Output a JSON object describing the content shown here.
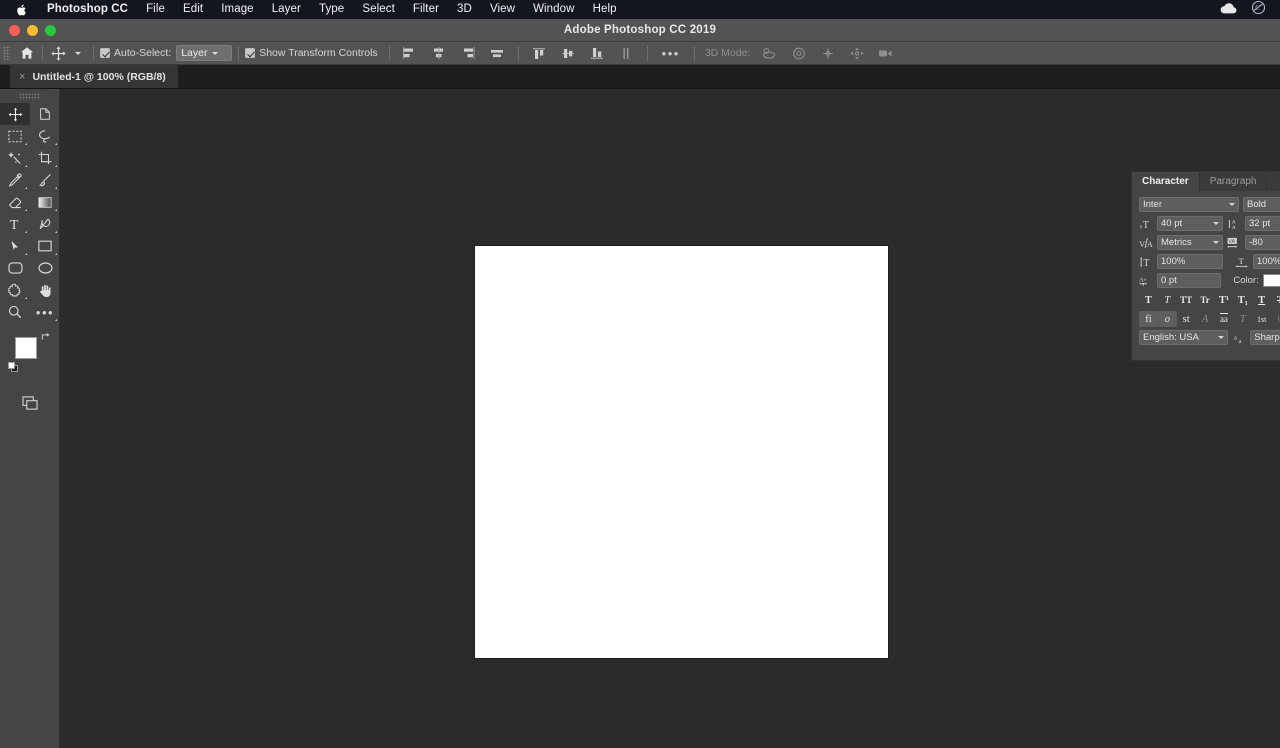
{
  "menubar": {
    "apple_icon": "apple-logo",
    "app_name": "Photoshop CC",
    "items": [
      "File",
      "Edit",
      "Image",
      "Layer",
      "Type",
      "Select",
      "Filter",
      "3D",
      "View",
      "Window",
      "Help"
    ],
    "right_icons": [
      "cloud-icon",
      "creative-cloud-icon"
    ]
  },
  "titlebar": {
    "title": "Adobe Photoshop CC 2019",
    "close_label": "close",
    "minimize_label": "minimize",
    "zoom_label": "zoom"
  },
  "options_bar": {
    "home_icon": "home-icon",
    "tool_icon": "move-tool-icon",
    "auto_select_checked": true,
    "auto_select_label": "Auto-Select:",
    "auto_select_value": "Layer",
    "show_transform_checked": true,
    "show_transform_label": "Show Transform Controls",
    "align_icons": [
      "align-left-edges",
      "align-horizontal-centers",
      "align-right-edges",
      "align-top-edges"
    ],
    "distribute_icons": [
      "distribute-top-edges",
      "distribute-vertical-centers",
      "distribute-bottom-edges",
      "distribute-horizontal-centers"
    ],
    "more_label": "•••",
    "mode_3d_label": "3D Mode:",
    "mode_3d_icons": [
      "rotate-3d-icon",
      "roll-3d-icon",
      "drag-3d-icon",
      "slide-3d-icon",
      "scale-3d-icon"
    ]
  },
  "document_tab": {
    "close": "×",
    "title": "Untitled-1 @ 100% (RGB/8)"
  },
  "toolbar": {
    "tools": [
      {
        "name": "move-tool",
        "glyph": "move",
        "active": true,
        "corner": false
      },
      {
        "name": "artboard-tool",
        "glyph": "artboard",
        "active": false,
        "corner": false
      },
      {
        "name": "rectangular-marquee-tool",
        "glyph": "marquee",
        "active": false,
        "corner": true
      },
      {
        "name": "lasso-tool",
        "glyph": "lasso",
        "active": false,
        "corner": true
      },
      {
        "name": "quick-selection-tool",
        "glyph": "wand",
        "active": false,
        "corner": true
      },
      {
        "name": "crop-tool",
        "glyph": "crop",
        "active": false,
        "corner": true
      },
      {
        "name": "eyedropper-tool",
        "glyph": "eyedropper",
        "active": false,
        "corner": true
      },
      {
        "name": "brush-tool",
        "glyph": "brush",
        "active": false,
        "corner": true
      },
      {
        "name": "eraser-tool",
        "glyph": "eraser",
        "active": false,
        "corner": true
      },
      {
        "name": "gradient-tool",
        "glyph": "gradient",
        "active": false,
        "corner": true
      },
      {
        "name": "type-tool",
        "glyph": "type",
        "active": false,
        "corner": true
      },
      {
        "name": "pen-tool",
        "glyph": "pen",
        "active": false,
        "corner": true
      },
      {
        "name": "path-selection-tool",
        "glyph": "arrow",
        "active": false,
        "corner": true
      },
      {
        "name": "rectangle-tool",
        "glyph": "rectangle",
        "active": false,
        "corner": true
      },
      {
        "name": "rounded-rectangle-tool",
        "glyph": "rounded-rect",
        "active": false,
        "corner": false
      },
      {
        "name": "ellipse-tool",
        "glyph": "ellipse",
        "active": false,
        "corner": false
      },
      {
        "name": "custom-shape-tool",
        "glyph": "custom-shape",
        "active": false,
        "corner": true
      },
      {
        "name": "hand-tool",
        "glyph": "hand",
        "active": false,
        "corner": false
      },
      {
        "name": "zoom-tool",
        "glyph": "zoom",
        "active": false,
        "corner": false
      },
      {
        "name": "edit-toolbar-tool",
        "glyph": "ellipsis",
        "active": false,
        "corner": true
      }
    ],
    "foreground_color": "#ffffff",
    "background_color": "#a8e6ca",
    "swap_icon": "swap-colors-icon",
    "default_icon": "default-colors-icon",
    "screen_mode_icon": "screen-mode-icon"
  },
  "canvas": {
    "background": "#ffffff",
    "workspace_background": "#2b2b2b"
  },
  "character_panel": {
    "tabs": [
      {
        "label": "Character",
        "active": true
      },
      {
        "label": "Paragraph",
        "active": false
      }
    ],
    "font_family": "Inter",
    "font_style": "Bold",
    "font_size_icon": "font-size-icon",
    "font_size": "40 pt",
    "leading_icon": "leading-icon",
    "leading": "32 pt",
    "kerning_icon": "kerning-icon",
    "kerning": "Metrics",
    "tracking_icon": "tracking-icon",
    "tracking": "-80",
    "vertical_scale_icon": "vertical-scale-icon",
    "vertical_scale": "100%",
    "horizontal_scale_icon": "horizontal-scale-icon",
    "horizontal_scale": "100%",
    "baseline_icon": "baseline-shift-icon",
    "baseline_shift": "0 pt",
    "color_label": "Color:",
    "color_value": "#ffffff",
    "style_buttons": [
      {
        "name": "faux-bold",
        "glyph": "T",
        "state": "on"
      },
      {
        "name": "faux-italic",
        "glyph": "T",
        "state": "off"
      },
      {
        "name": "all-caps",
        "glyph": "TT",
        "state": "off"
      },
      {
        "name": "small-caps",
        "glyph": "Tr",
        "state": "off"
      },
      {
        "name": "superscript",
        "glyph": "T¹",
        "state": "off"
      },
      {
        "name": "subscript",
        "glyph": "T₁",
        "state": "off"
      },
      {
        "name": "underline",
        "glyph": "T",
        "state": "off"
      },
      {
        "name": "strikethrough",
        "glyph": "T",
        "state": "off"
      }
    ],
    "opentype_buttons": [
      {
        "name": "standard-ligatures",
        "glyph": "fi",
        "state": "on"
      },
      {
        "name": "contextual-alternates",
        "glyph": "o",
        "state": "on"
      },
      {
        "name": "discretionary-ligatures",
        "glyph": "st",
        "state": "off"
      },
      {
        "name": "swash",
        "glyph": "A",
        "state": "dim"
      },
      {
        "name": "oldstyle",
        "glyph": "aa",
        "state": "off"
      },
      {
        "name": "stylistic-alternates",
        "glyph": "T",
        "state": "dim"
      },
      {
        "name": "ordinals",
        "glyph": "1st",
        "state": "off"
      },
      {
        "name": "fractions",
        "glyph": "½",
        "state": "dim"
      }
    ],
    "language": "English: USA",
    "antialias_icon": "antialias-icon",
    "antialias_method": "Sharp"
  }
}
